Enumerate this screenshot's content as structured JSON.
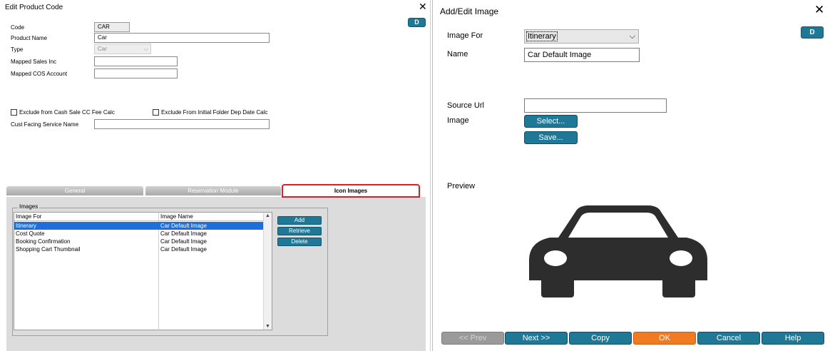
{
  "left": {
    "title": "Edit Product Code",
    "close": "✕",
    "d_button": "D",
    "fields": {
      "code_label": "Code",
      "code_value": "CAR",
      "product_name_label": "Product Name",
      "product_name_value": "Car",
      "type_label": "Type",
      "type_value": "Car",
      "mapped_sales_label": "Mapped Sales Inc",
      "mapped_sales_value": "",
      "mapped_cos_label": "Mapped COS Account",
      "mapped_cos_value": "",
      "exclude_cash_sale_label": "Exclude from Cash Sale CC Fee Calc",
      "exclude_initial_folder_label": "Exclude From Initial Folder Dep Date Calc",
      "cust_facing_label": "Cust Facing Service Name",
      "cust_facing_value": ""
    },
    "tabs": [
      "General",
      "Reservation Module",
      "Icon Images"
    ],
    "images_group_label": "Images",
    "list": {
      "headers": [
        "Image For",
        "Image Name"
      ],
      "rows": [
        [
          "Itinerary",
          "Car Default Image"
        ],
        [
          "Cost Quote",
          "Car Default Image"
        ],
        [
          "Booking Confirmation",
          "Car Default Image"
        ],
        [
          "Shopping Cart Thumbnail",
          "Car Default Image"
        ]
      ]
    },
    "buttons": {
      "add": "Add",
      "retrieve": "Retrieve",
      "delete": "Delete"
    }
  },
  "right": {
    "title": "Add/Edit Image",
    "close": "✕",
    "d_button": "D",
    "image_for_label": "Image For",
    "image_for_value": "Itinerary",
    "name_label": "Name",
    "name_value": "Car Default Image",
    "source_url_label": "Source Url",
    "source_url_value": "",
    "image_label": "Image",
    "select_button": "Select...",
    "save_button": "Save...",
    "preview_label": "Preview",
    "footer": {
      "prev": "<< Prev",
      "next": "Next >>",
      "copy": "Copy",
      "ok": "OK",
      "cancel": "Cancel",
      "help": "Help"
    }
  },
  "colors": {
    "button_teal": "#1f7896",
    "ok_orange": "#f07b22",
    "selection_blue": "#1e6fd9",
    "active_tab_outline": "#d8202a"
  },
  "icons": [
    "close-icon",
    "chevron-down-icon",
    "car-icon",
    "scroll-up-icon",
    "scroll-down-icon"
  ]
}
